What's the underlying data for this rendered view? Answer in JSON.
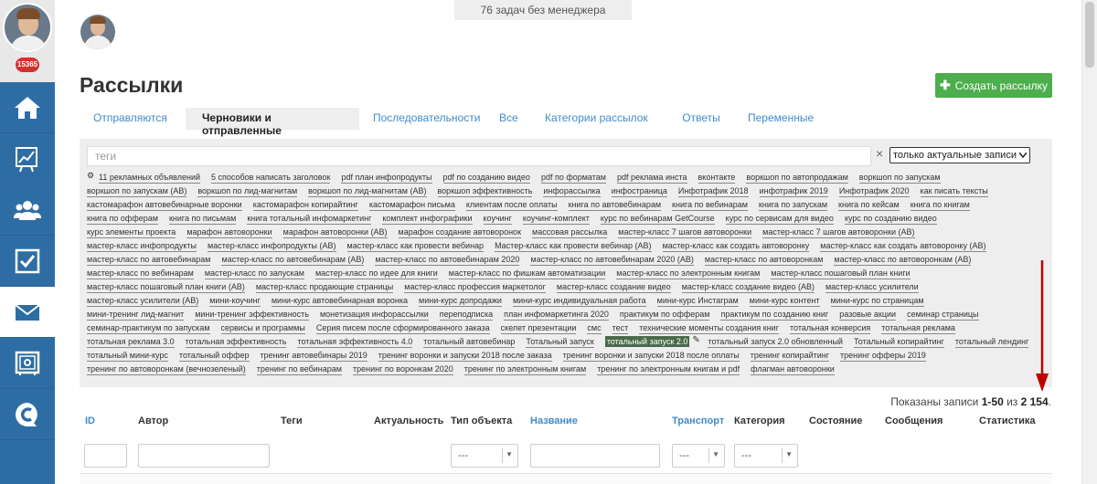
{
  "sidebar": {
    "badge": "15365",
    "items": [
      {
        "icon": "home-icon"
      },
      {
        "icon": "chart-icon"
      },
      {
        "icon": "users-icon"
      },
      {
        "icon": "tasks-icon"
      },
      {
        "icon": "mail-icon",
        "active": true
      },
      {
        "icon": "safe-icon"
      },
      {
        "icon": "chat-icon"
      }
    ]
  },
  "notice": "76 задач без менеджера",
  "page": {
    "title": "Рассылки",
    "create_button": "Создать рассылку"
  },
  "tabs": [
    "Отправляются",
    "Черновики и отправленные",
    "Последовательности",
    "Все",
    "Категории рассылок",
    "Ответы",
    "Переменные"
  ],
  "filter": {
    "tags_placeholder": "теги",
    "clear": "×",
    "select_value": "только актуальные записи"
  },
  "tags": [
    [
      "11 рекламных объявлений",
      "5 способов написать заголовок",
      "pdf план инфопродукты",
      "pdf по созданию видео",
      "pdf по форматам",
      "pdf реклама инста",
      "вконтакте",
      "воркшоп по автопродажам",
      "воркшоп по запускам"
    ],
    [
      "воркшоп по запускам (АВ)",
      "воркшоп по лид-магнитам",
      "воркшоп по лид-магнитам (АВ)",
      "воркшоп эффективность",
      "инфорассылка",
      "инфостраница",
      "Инфотрафик 2018",
      "инфотрафик 2019",
      "Инфотрафик 2020",
      "как писать тексты"
    ],
    [
      "кастомарафон автовебинарные воронки",
      "кастомарафон копирайтинг",
      "кастомарафон письма",
      "клиентам после оплаты",
      "книга по автовебинарам",
      "книга по вебинарам",
      "книга по запускам",
      "книга по кейсам",
      "книга по книгам"
    ],
    [
      "книга по офферам",
      "книга по письмам",
      "книга тотальный инфомаркетинг",
      "комплект инфографики",
      "коучинг",
      "коучинг-комплект",
      "курс по вебинарам GetCourse",
      "курс по сервисам для видео",
      "курс по созданию видео"
    ],
    [
      "курс элементы проекта",
      "марафон автоворонки",
      "марафон автоворонки (АВ)",
      "марафон создание автоворонок",
      "массовая рассылка",
      "мастер-класс 7 шагов автоворонки",
      "мастер-класс 7 шагов автоворонки (АВ)"
    ],
    [
      "мастер-класс инфопродукты",
      "мастер-класс инфопродукты (АВ)",
      "мастер-класс как провести вебинар",
      "Мастер-класс как провести вебинар (АВ)",
      "мастер-класс как создать автоворонку",
      "мастер-класс как создать автоворонку (АВ)"
    ],
    [
      "мастер-класс по автовебинарам",
      "мастер-класс по автовебинарам (АВ)",
      "мастер-класс по автовебинарам 2020",
      "мастер-класс по автовебинарам 2020 (АВ)",
      "мастер-класс по автоворонкам",
      "мастер-класс по автоворонкам (АВ)"
    ],
    [
      "мастер-класс по вебинарам",
      "мастер-класс по запускам",
      "мастер-класс по идее для книги",
      "мастер-класс по фишкам автоматизации",
      "мастер-класс по электронным книгам",
      "мастер-класс пошаговый план книги"
    ],
    [
      "мастер-класс пошаговый план книги (АВ)",
      "мастер-класс продающие страницы",
      "мастер-класс профессия маркетолог",
      "мастер-класс создание видео",
      "мастер-класс создание видео (АВ)",
      "мастер-класс усилители"
    ],
    [
      "мастер-класс усилители (АВ)",
      "мини-коучинг",
      "мини-курс автовебинарная воронка",
      "мини-курс допродажи",
      "мини-курс индивидуальная работа",
      "мини-курс Инстаграм",
      "мини-курс контент",
      "мини-курс по страницам"
    ],
    [
      "мини-тренинг лид-магнит",
      "мини-тренинг эффективность",
      "монетизация инфорассылки",
      "переподписка",
      "план инфомаркетинга 2020",
      "практикум по офферам",
      "практикум по созданию книг",
      "разовые акции",
      "семинар страницы"
    ],
    [
      "семинар-практикум по запускам",
      "сервисы и программы",
      "Серия писем после сформированного заказа",
      "скелет презентации",
      "смс",
      "тест",
      "технические моменты создания книг",
      "тотальная конверсия",
      "тотальная реклама"
    ],
    [
      "тотальная реклама 3.0",
      "тотальная эффективность",
      "тотальная эффективность 4.0",
      "тотальный автовебинар",
      "Тотальный запуск",
      "тотальный запуск 2.0",
      "тотальный запуск 2.0 обновленный",
      "Тотальный копирайтинг",
      "тотальный лендинг"
    ],
    [
      "тотальный мини-курс",
      "тотальный оффер",
      "тренинг автовебинары 2019",
      "тренинг воронки и запуски 2018 после заказа",
      "тренинг воронки и запуски 2018 после оплаты",
      "тренинг копирайтинг",
      "тренинг офферы 2019"
    ],
    [
      "тренинг по автоворонкам (вечнозеленый)",
      "тренинг по вебинарам",
      "тренинг по воронкам 2020",
      "тренинг по электронным книгам",
      "тренинг по электронным книгам и pdf",
      "флагман автоворонки"
    ]
  ],
  "selected_tag": "тотальный запуск 2.0",
  "records": {
    "prefix": "Показаны записи ",
    "range": "1-50",
    "middle": " из ",
    "total": "2 154",
    "suffix": "."
  },
  "table": {
    "headers": [
      "ID",
      "Автор",
      "Теги",
      "Актуальность",
      "Тип объекта",
      "Название",
      "Транспорт",
      "Категория",
      "Состояние",
      "Сообщения",
      "Статистика"
    ],
    "select_placeholder": "---"
  },
  "colors": {
    "sidebar": "#2e6da4",
    "link": "#428bca",
    "create_button": "#4cae4c",
    "arrow": "#c00000"
  }
}
